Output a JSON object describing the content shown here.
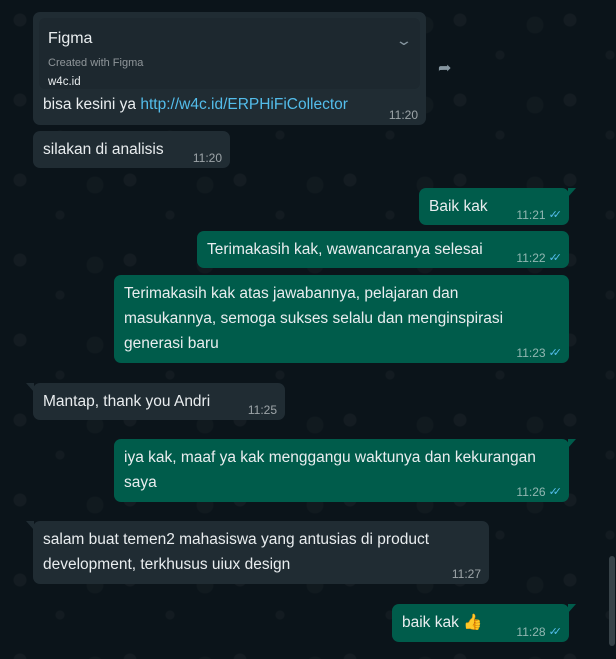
{
  "messages": [
    {
      "direction": "in",
      "preview": {
        "title": "Figma",
        "subtitle": "Created with Figma",
        "domain": "w4c.id"
      },
      "text": "bisa kesini ya ",
      "link": "http://w4c.id/ERPHiFiCollector",
      "time": "11:20"
    },
    {
      "direction": "in",
      "text": "silakan di analisis",
      "time": "11:20"
    },
    {
      "direction": "out",
      "text": "Baik kak",
      "time": "11:21"
    },
    {
      "direction": "out",
      "text": "Terimakasih kak, wawancaranya selesai",
      "time": "11:22"
    },
    {
      "direction": "out",
      "lines": [
        "Terimakasih kak atas jawabannya, pelajaran dan",
        "masukannya, semoga sukses selalu dan menginspirasi",
        "generasi baru"
      ],
      "time": "11:23"
    },
    {
      "direction": "in",
      "text": "Mantap, thank you Andri",
      "time": "11:25"
    },
    {
      "direction": "out",
      "lines": [
        "iya kak, maaf ya kak menggangu waktunya dan kekurangan",
        "saya"
      ],
      "time": "11:26"
    },
    {
      "direction": "in",
      "lines": [
        "salam buat temen2 mahasiswa yang antusias di product",
        "development, terkhusus uiux design"
      ],
      "time": "11:27"
    },
    {
      "direction": "out",
      "text": "baik kak 👍",
      "time": "11:28"
    }
  ],
  "icons": {
    "forward": "forward-icon",
    "expand": "chevron-down-icon",
    "read_receipt": "double-check-icon"
  },
  "colors": {
    "incoming": "#202c33",
    "outgoing": "#005c4b",
    "link": "#53bdeb",
    "read_ticks": "#53bdeb",
    "background": "#0b141a"
  }
}
